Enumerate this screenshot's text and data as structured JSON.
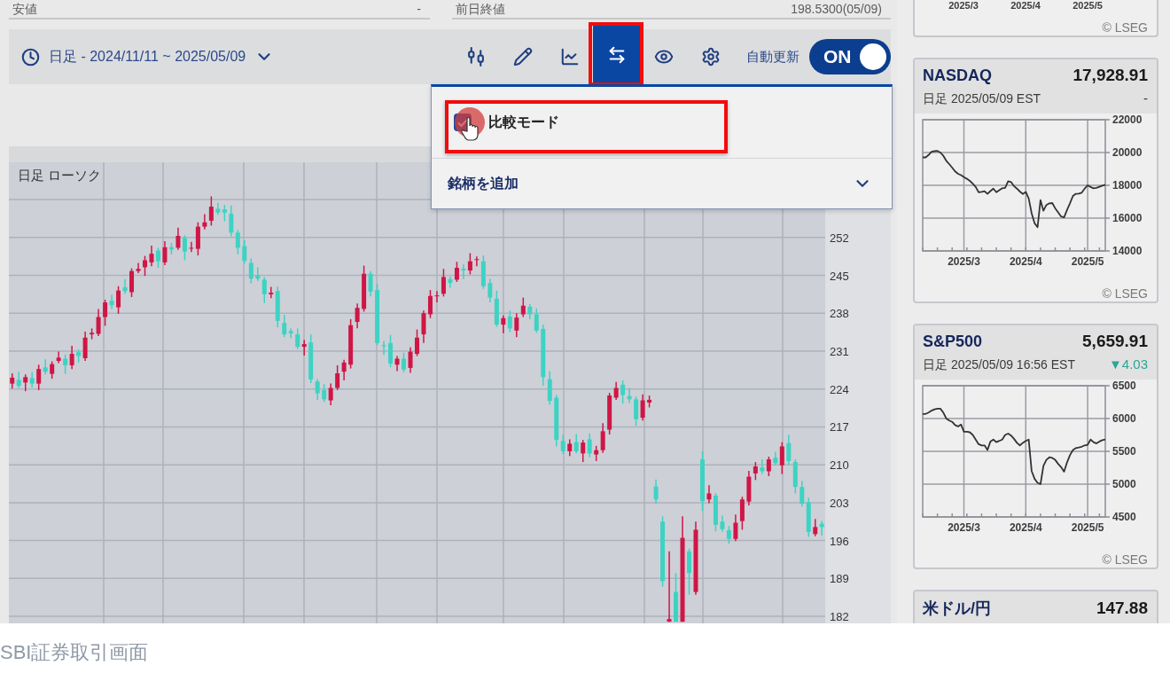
{
  "summary_fields": [
    {
      "label": "安値",
      "value": "-"
    },
    {
      "label": "前日終値",
      "value": "198.5300(05/09)"
    }
  ],
  "toolbar": {
    "period": "日足 - 2024/11/11 ~ 2025/05/09",
    "tools": [
      {
        "kind": "candles",
        "selected": false,
        "highlighted": false
      },
      {
        "kind": "draw",
        "selected": false,
        "highlighted": false
      },
      {
        "kind": "trend",
        "selected": false,
        "highlighted": false
      },
      {
        "kind": "compare",
        "selected": true,
        "highlighted": true
      },
      {
        "kind": "visibility",
        "selected": false,
        "highlighted": false
      },
      {
        "kind": "settings",
        "selected": false,
        "highlighted": false
      }
    ],
    "auto_update": {
      "label": "自動更新",
      "toggle": "ON",
      "on": true
    }
  },
  "compare_menu": {
    "items": [
      {
        "kind": "checkbox",
        "label": "比較モード",
        "checked": true,
        "highlighted": true,
        "pointer": true
      },
      {
        "kind": "expander",
        "label": "銘柄を追加",
        "expanded": false,
        "highlighted": false,
        "pointer": false
      }
    ]
  },
  "chart": {
    "chart_data": {
      "type": "candlestick",
      "title": "日足 ローソク",
      "categories": [
        null,
        null,
        null,
        null,
        null,
        null,
        null,
        null,
        null,
        null,
        null,
        null,
        null,
        null,
        null,
        null,
        null,
        null,
        null,
        null,
        null,
        null,
        null,
        null,
        null,
        null,
        null,
        null,
        null,
        null,
        null,
        null,
        null,
        null,
        null,
        null,
        null,
        null,
        null,
        null,
        null,
        null,
        null,
        null,
        null,
        null,
        null,
        null,
        null,
        null,
        null,
        null,
        null,
        null,
        null,
        null,
        null,
        null,
        null,
        null,
        null,
        null,
        null,
        null,
        null,
        null,
        null,
        null,
        null,
        null,
        null,
        null,
        null,
        null,
        null,
        null,
        null,
        null,
        null,
        null,
        null,
        null,
        null,
        null,
        null,
        null,
        null,
        null,
        null,
        null,
        null,
        null,
        null,
        null,
        null,
        null,
        null,
        null,
        null,
        null,
        null,
        null,
        null,
        null,
        null,
        null,
        null,
        null,
        null,
        null,
        null,
        null,
        null,
        null,
        null,
        null,
        null,
        null,
        null,
        null,
        null,
        null,
        null
      ],
      "ylim": [
        180.7,
        265.9
      ],
      "yticks": [
        182,
        189,
        196,
        203,
        210,
        217,
        224,
        231,
        238,
        245,
        252
      ],
      "grid": true,
      "ohlc": [
        [
          225.0,
          226.9,
          224.1,
          226.1
        ],
        [
          225.7,
          227.2,
          224.2,
          224.6
        ],
        [
          225.2,
          226.7,
          223.6,
          226.2
        ],
        [
          226.0,
          227.1,
          224.3,
          225.0
        ],
        [
          225.0,
          228.5,
          223.8,
          227.7
        ],
        [
          228.0,
          229.5,
          226.7,
          227.2
        ],
        [
          226.8,
          229.1,
          225.9,
          228.6
        ],
        [
          229.2,
          230.9,
          228.8,
          229.8
        ],
        [
          229.6,
          230.4,
          226.8,
          228.4
        ],
        [
          228.4,
          232.0,
          227.7,
          230.5
        ],
        [
          230.8,
          231.3,
          228.9,
          230.1
        ],
        [
          229.7,
          234.6,
          229.2,
          233.5
        ],
        [
          234.1,
          235.2,
          233.2,
          234.4
        ],
        [
          234.2,
          238.8,
          233.8,
          237.3
        ],
        [
          237.3,
          240.5,
          235.7,
          240.0
        ],
        [
          240.3,
          241.4,
          238.8,
          239.5
        ],
        [
          239.1,
          243.0,
          237.9,
          242.2
        ],
        [
          242.8,
          244.3,
          241.6,
          242.1
        ],
        [
          241.9,
          246.3,
          241.0,
          245.8
        ],
        [
          245.8,
          247.3,
          245.4,
          246.2
        ],
        [
          246.5,
          248.6,
          244.9,
          247.8
        ],
        [
          247.4,
          250.5,
          246.7,
          249.0
        ],
        [
          249.6,
          250.1,
          246.4,
          247.6
        ],
        [
          247.4,
          251.3,
          246.9,
          250.2
        ],
        [
          250.2,
          251.0,
          248.9,
          249.8
        ],
        [
          250.1,
          253.8,
          249.7,
          252.3
        ],
        [
          251.9,
          252.4,
          247.8,
          249.4
        ],
        [
          250.0,
          251.2,
          249.3,
          250.1
        ],
        [
          249.9,
          254.8,
          248.7,
          254.0
        ],
        [
          254.0,
          256.3,
          253.5,
          254.8
        ],
        [
          255.1,
          259.6,
          254.2,
          257.7
        ],
        [
          257.3,
          258.4,
          256.2,
          256.6
        ],
        [
          257.2,
          258.0,
          255.0,
          256.6
        ],
        [
          256.4,
          257.9,
          252.2,
          252.9
        ],
        [
          252.9,
          253.4,
          248.9,
          250.1
        ],
        [
          250.4,
          251.5,
          247.2,
          247.7
        ],
        [
          247.3,
          248.1,
          243.5,
          244.4
        ],
        [
          245.0,
          246.5,
          244.0,
          244.4
        ],
        [
          244.2,
          244.7,
          239.9,
          241.5
        ],
        [
          241.5,
          242.9,
          240.8,
          241.8
        ],
        [
          242.1,
          242.9,
          235.4,
          236.6
        ],
        [
          236.2,
          237.7,
          233.6,
          234.1
        ],
        [
          234.7,
          235.2,
          233.4,
          234.3
        ],
        [
          234.1,
          235.2,
          231.4,
          231.8
        ],
        [
          231.8,
          233.1,
          230.2,
          232.3
        ],
        [
          232.6,
          234.1,
          225.1,
          225.8
        ],
        [
          225.4,
          225.9,
          222.0,
          223.2
        ],
        [
          223.8,
          224.9,
          221.6,
          222.1
        ],
        [
          221.9,
          225.0,
          221.0,
          224.2
        ],
        [
          224.2,
          228.4,
          223.8,
          226.9
        ],
        [
          227.2,
          229.4,
          225.6,
          228.9
        ],
        [
          228.5,
          236.9,
          227.8,
          235.8
        ],
        [
          236.4,
          239.8,
          235.2,
          239.0
        ],
        [
          238.8,
          246.8,
          238.3,
          245.3
        ],
        [
          245.3,
          245.8,
          241.1,
          242.0
        ],
        [
          242.3,
          243.4,
          232.1,
          232.5
        ],
        [
          232.1,
          232.9,
          230.3,
          231.9
        ],
        [
          232.5,
          234.0,
          228.0,
          228.7
        ],
        [
          228.5,
          230.1,
          227.3,
          229.6
        ],
        [
          229.6,
          230.7,
          227.1,
          227.6
        ],
        [
          227.9,
          231.7,
          227.0,
          230.9
        ],
        [
          230.5,
          235.0,
          230.1,
          233.5
        ],
        [
          234.1,
          238.5,
          232.5,
          238.0
        ],
        [
          237.8,
          242.3,
          237.1,
          241.2
        ],
        [
          241.2,
          242.1,
          240.0,
          241.3
        ],
        [
          241.6,
          246.2,
          241.1,
          244.7
        ],
        [
          244.3,
          244.8,
          242.7,
          243.6
        ],
        [
          244.2,
          247.5,
          243.8,
          246.4
        ],
        [
          246.2,
          247.0,
          244.3,
          245.9
        ],
        [
          245.9,
          249.1,
          245.2,
          247.6
        ],
        [
          247.9,
          248.5,
          246.7,
          248.0
        ],
        [
          247.6,
          248.7,
          242.5,
          243.0
        ],
        [
          243.6,
          244.4,
          240.0,
          240.9
        ],
        [
          240.7,
          242.2,
          235.5,
          235.9
        ],
        [
          235.9,
          237.6,
          234.3,
          237.1
        ],
        [
          237.4,
          238.5,
          234.5,
          235.2
        ],
        [
          234.8,
          238.0,
          233.6,
          237.2
        ],
        [
          237.8,
          240.9,
          237.3,
          239.4
        ],
        [
          239.2,
          239.7,
          236.9,
          237.8
        ],
        [
          237.8,
          238.9,
          234.4,
          234.8
        ],
        [
          235.1,
          235.9,
          224.6,
          226.2
        ],
        [
          225.8,
          227.3,
          221.1,
          221.8
        ],
        [
          222.4,
          222.9,
          213.4,
          214.6
        ],
        [
          214.4,
          215.5,
          212.0,
          212.5
        ],
        [
          212.5,
          214.7,
          211.6,
          213.9
        ],
        [
          214.2,
          215.7,
          212.1,
          212.5
        ],
        [
          212.1,
          214.6,
          210.5,
          214.1
        ],
        [
          214.7,
          215.8,
          211.4,
          212.1
        ],
        [
          211.9,
          213.5,
          210.7,
          212.7
        ],
        [
          212.7,
          217.7,
          212.2,
          216.2
        ],
        [
          216.5,
          223.3,
          215.6,
          222.8
        ],
        [
          222.4,
          225.3,
          222.0,
          224.2
        ],
        [
          224.8,
          225.6,
          221.3,
          222.9
        ],
        [
          222.7,
          224.2,
          221.4,
          222.1
        ],
        [
          222.1,
          222.6,
          217.2,
          218.4
        ],
        [
          218.7,
          223.0,
          218.2,
          221.9
        ],
        [
          221.5,
          222.8,
          220.6,
          222.0
        ],
        [
          206.0,
          207.3,
          202.8,
          203.6
        ],
        [
          199.5,
          200.5,
          187.5,
          188.5
        ],
        [
          181.0,
          194.0,
          181.0,
          181.5
        ],
        [
          186.5,
          190.0,
          181.0,
          181.0
        ],
        [
          181.0,
          200.5,
          181.0,
          196.5
        ],
        [
          194.0,
          194.5,
          186.0,
          190.0
        ],
        [
          186.5,
          199.5,
          186.0,
          198.0
        ],
        [
          211.0,
          212.5,
          201.5,
          203.3
        ],
        [
          203.6,
          206.2,
          202.9,
          204.7
        ],
        [
          204.3,
          204.8,
          197.7,
          198.9
        ],
        [
          199.5,
          200.6,
          197.6,
          198.1
        ],
        [
          197.9,
          198.7,
          195.4,
          196.3
        ],
        [
          196.3,
          200.8,
          195.9,
          199.3
        ],
        [
          199.6,
          204.1,
          198.0,
          203.6
        ],
        [
          203.2,
          208.9,
          202.5,
          207.8
        ],
        [
          208.4,
          210.5,
          207.2,
          209.7
        ],
        [
          209.5,
          211.0,
          208.3,
          208.8
        ],
        [
          208.8,
          211.5,
          207.9,
          211.0
        ],
        [
          211.3,
          212.4,
          209.9,
          210.3
        ],
        [
          209.9,
          214.2,
          208.3,
          213.4
        ],
        [
          214.0,
          215.5,
          210.0,
          210.7
        ],
        [
          210.5,
          211.0,
          204.7,
          205.9
        ],
        [
          205.9,
          207.0,
          202.3,
          202.8
        ],
        [
          203.1,
          203.9,
          196.7,
          197.6
        ],
        [
          197.2,
          200.0,
          196.8,
          198.5
        ],
        [
          199.1,
          199.6,
          196.9,
          198.5
        ]
      ]
    }
  },
  "market_cards": [
    {
      "kind": "partial",
      "x_labels": [
        "2025/3",
        "2025/4",
        "2025/5"
      ],
      "credit": "© LSEG"
    },
    {
      "kind": "chart",
      "name": "NASDAQ",
      "price": "17,928.91",
      "subtitle": "日足 2025/05/09 EST",
      "change": "-",
      "down": false,
      "chart_data": {
        "type": "line",
        "categories": [
          null,
          null,
          null,
          null,
          null,
          null,
          null,
          null,
          null,
          null,
          null,
          null,
          null,
          null,
          "2025/3",
          null,
          null,
          null,
          null,
          null,
          null,
          null,
          null,
          null,
          null,
          null,
          null,
          null,
          null,
          null,
          null,
          null,
          null,
          null,
          null,
          "2025/4",
          null,
          null,
          null,
          null,
          null,
          null,
          null,
          null,
          null,
          null,
          null,
          null,
          null,
          null,
          null,
          null,
          null,
          null,
          null,
          null,
          "2025/5",
          null,
          null,
          null,
          null,
          null,
          null
        ],
        "values": [
          19700,
          19700,
          19850,
          20050,
          20080,
          20100,
          20000,
          19800,
          19500,
          19300,
          19080,
          18850,
          18700,
          18620,
          18500,
          18400,
          18270,
          18100,
          17900,
          17580,
          17600,
          17640,
          17480,
          17650,
          17800,
          17580,
          17700,
          17820,
          17850,
          18250,
          18200,
          17950,
          17800,
          17620,
          17470,
          17600,
          17200,
          16300,
          15680,
          15450,
          17100,
          16450,
          16800,
          16900,
          16920,
          16600,
          16350,
          16100,
          16050,
          16500,
          16900,
          17350,
          17480,
          17500,
          17550,
          17800,
          18000,
          17900,
          17820,
          17850,
          17910,
          17980,
          18040
        ],
        "ylim": [
          14000,
          22000
        ],
        "yticks": [
          14000,
          16000,
          18000,
          20000,
          22000
        ],
        "grid": true
      },
      "credit": "© LSEG"
    },
    {
      "kind": "chart",
      "name": "S&P500",
      "price": "5,659.91",
      "subtitle": "日足 2025/05/09 16:56 EST",
      "change": "▼4.03",
      "down": true,
      "chart_data": {
        "type": "line",
        "categories": [
          null,
          null,
          null,
          null,
          null,
          null,
          null,
          null,
          null,
          null,
          null,
          null,
          null,
          null,
          "2025/3",
          null,
          null,
          null,
          null,
          null,
          null,
          null,
          null,
          null,
          null,
          null,
          null,
          null,
          null,
          null,
          null,
          null,
          null,
          null,
          null,
          "2025/4",
          null,
          null,
          null,
          null,
          null,
          null,
          null,
          null,
          null,
          null,
          null,
          null,
          null,
          null,
          null,
          null,
          null,
          null,
          null,
          null,
          "2025/5",
          null,
          null,
          null,
          null,
          null,
          null
        ],
        "values": [
          6070,
          6070,
          6090,
          6120,
          6140,
          6150,
          6150,
          6090,
          6000,
          5970,
          5950,
          5900,
          5880,
          5910,
          5800,
          5800,
          5790,
          5750,
          5680,
          5610,
          5590,
          5590,
          5520,
          5650,
          5680,
          5640,
          5660,
          5680,
          5750,
          5770,
          5740,
          5690,
          5630,
          5590,
          5630,
          5660,
          5680,
          5200,
          5080,
          5020,
          5000,
          5280,
          5370,
          5410,
          5400,
          5370,
          5310,
          5260,
          5190,
          5330,
          5440,
          5520,
          5550,
          5560,
          5570,
          5590,
          5600,
          5680,
          5640,
          5620,
          5650,
          5670,
          5680
        ],
        "ylim": [
          4500,
          6500
        ],
        "yticks": [
          4500,
          5000,
          5500,
          6000,
          6500
        ],
        "grid": true
      },
      "credit": "© LSEG"
    },
    {
      "kind": "header",
      "name": "米ドル/円",
      "price": "147.88"
    }
  ],
  "caption": "SBI証券取引画面"
}
